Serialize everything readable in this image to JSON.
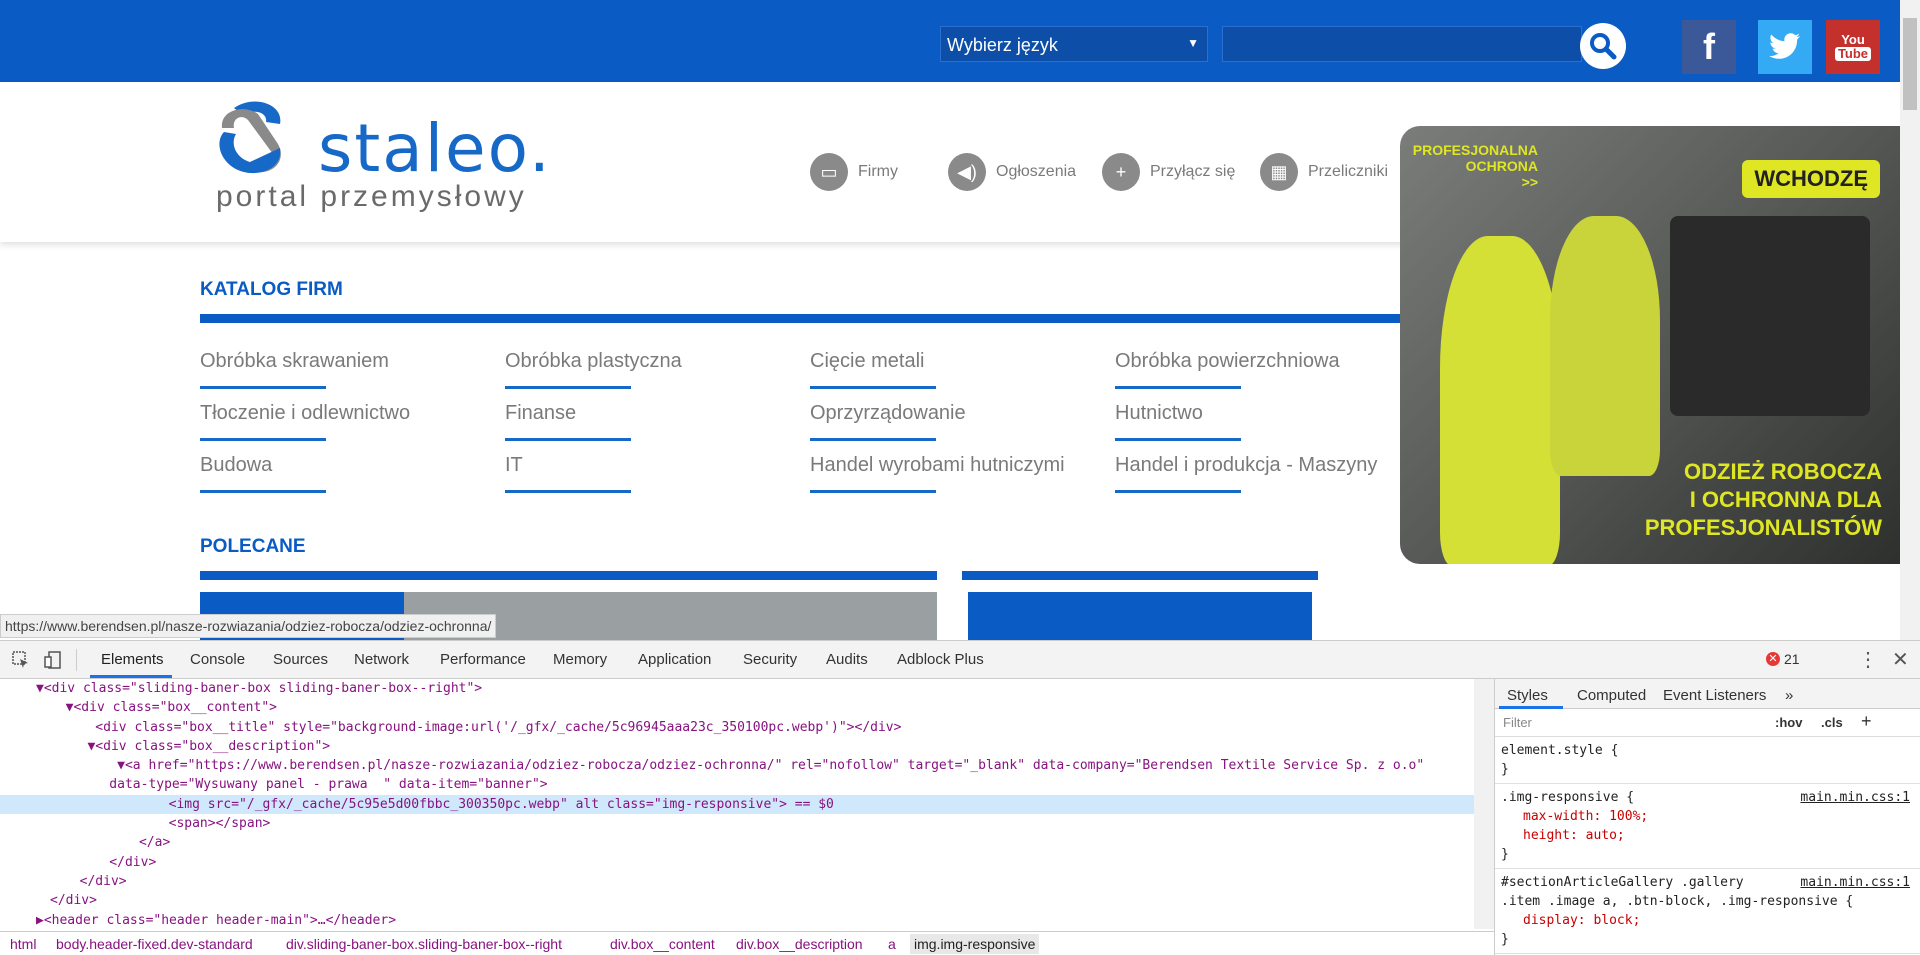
{
  "topbar": {
    "language_select": "Wybierz język",
    "social": {
      "facebook": "f",
      "youtube_line1": "You",
      "youtube_line2": "Tube"
    }
  },
  "logo": {
    "main": "staleo.",
    "sub": "portal przemysłowy"
  },
  "nav": [
    {
      "label": "Firmy",
      "icon": "folder-icon"
    },
    {
      "label": "Ogłoszenia",
      "icon": "speaker-icon"
    },
    {
      "label": "Przyłącz się",
      "icon": "plus-icon"
    },
    {
      "label": "Przeliczniki",
      "icon": "calculator-icon"
    }
  ],
  "catalog": {
    "title": "KATALOG FIRM",
    "items": [
      "Obróbka skrawaniem",
      "Obróbka plastyczna",
      "Cięcie metali",
      "Obróbka powierzchniowa",
      "Tłoczenie i odlewnictwo",
      "Finanse",
      "Oprzyrządowanie",
      "Hutnictwo",
      "Budowa",
      "IT",
      "Handel wyrobami hutniczymi",
      "Handel i produkcja - Maszyny"
    ]
  },
  "polecane": {
    "title": "POLECANE"
  },
  "ad": {
    "corner_line1": "PROFESJONALNA",
    "corner_line2": "OCHRONA",
    "corner_line3": ">>",
    "badge": "WCHODZĘ",
    "caption_line1": "ODZIEŻ ROBOCZA",
    "caption_line2": "I OCHRONNA DLA",
    "caption_line3": "PROFESJONALISTÓW"
  },
  "status_url": "https://www.berendsen.pl/nasze-rozwiazania/odziez-robocza/odziez-ochronna/",
  "devtools": {
    "tabs": [
      "Elements",
      "Console",
      "Sources",
      "Network",
      "Performance",
      "Memory",
      "Application",
      "Security",
      "Audits",
      "Adblock Plus"
    ],
    "error_count": "21",
    "code_lines": [
      "▼<div class=\"sliding-baner-box sliding-baner-box--right\">",
      "  ▼<div class=\"box__content\">",
      "    <div class=\"box__title\" style=\"background-image:url('/_gfx/_cache/5c96945aaa23c_350100pc.webp')\"></div>",
      "   ▼<div class=\"box__description\">",
      "     ▼<a href=\"https://www.berendsen.pl/nasze-rozwiazania/odziez-robocza/odziez-ochronna/\" rel=\"nofollow\" target=\"_blank\" data-company=\"Berendsen Textile Service Sp. z o.o\"",
      "    data-type=\"Wysuwany panel - prawa  \" data-item=\"banner\">",
      "        <img src=\"/_gfx/_cache/5c95e5d00fbbc_300350pc.webp\" alt class=\"img-responsive\"> == $0",
      "        <span></span>",
      "      </a>",
      "    </div>",
      "  </div>",
      "</div>",
      "▶<header class=\"header header-main\">…</header>"
    ],
    "breadcrumbs": [
      "html",
      "body.header-fixed.dev-standard",
      "div.sliding-baner-box.sliding-baner-box--right",
      "div.box__content",
      "div.box__description",
      "a",
      "img.img-responsive"
    ],
    "styles": {
      "tabs": [
        "Styles",
        "Computed",
        "Event Listeners",
        "»"
      ],
      "filter_placeholder": "Filter",
      "hov": ":hov",
      "cls": ".cls",
      "rules": [
        {
          "selector": "element.style {",
          "props": [],
          "close": "}",
          "source": ""
        },
        {
          "selector": ".img-responsive {",
          "props": [
            "max-width: 100%;",
            "height: auto;"
          ],
          "close": "}",
          "source": "main.min.css:1"
        },
        {
          "selector": "#sectionArticleGallery .gallery",
          "selector2": ".item .image a, .btn-block, .img-responsive {",
          "props": [
            "display: block;"
          ],
          "close": "}",
          "source": "main.min.css:1"
        }
      ]
    }
  }
}
